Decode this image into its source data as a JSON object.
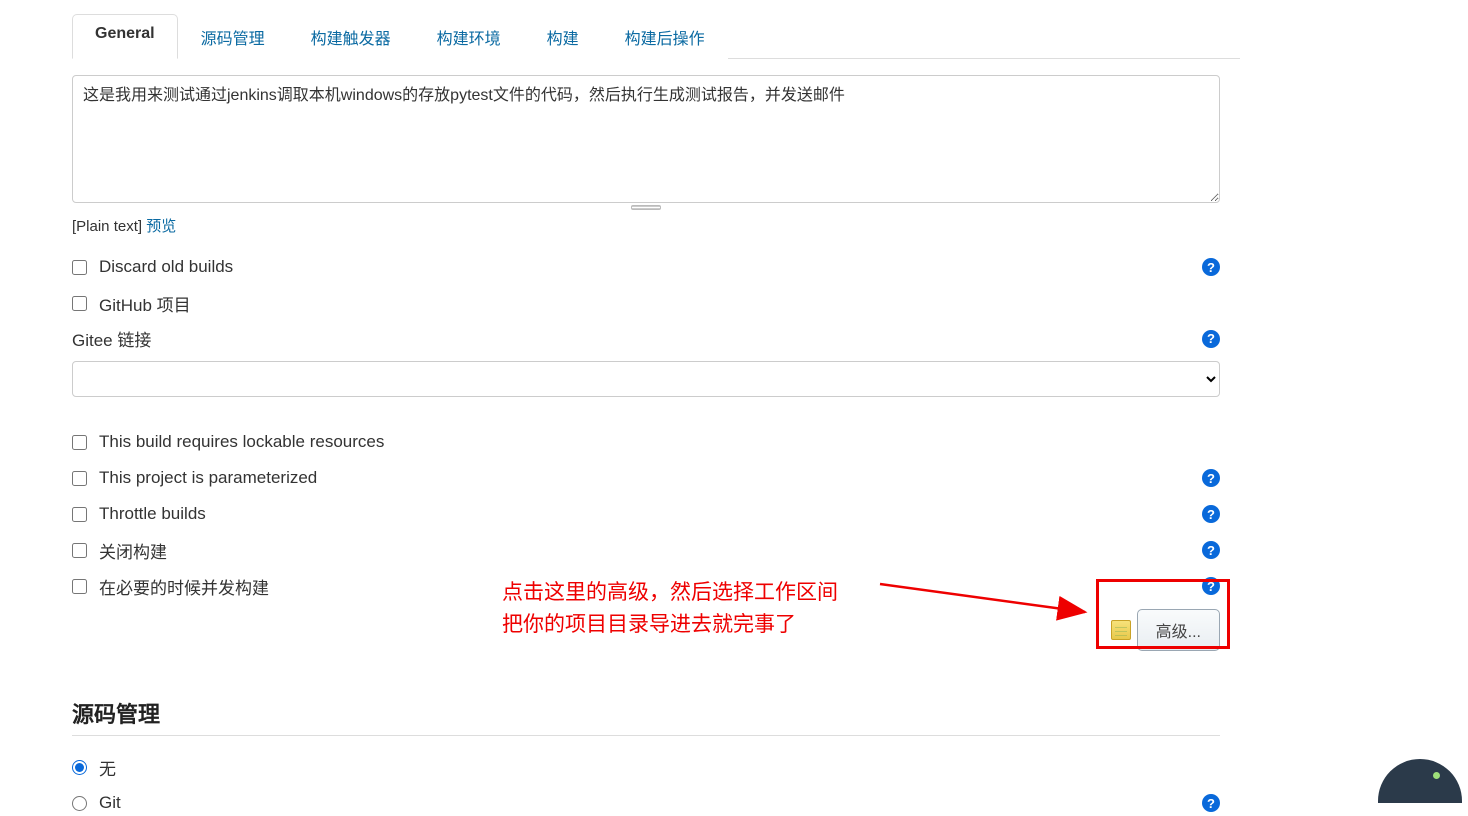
{
  "tabs": {
    "general": "General",
    "scm": "源码管理",
    "triggers": "构建触发器",
    "env": "构建环境",
    "build": "构建",
    "postbuild": "构建后操作"
  },
  "description": "这是我用来测试通过jenkins调取本机windows的存放pytest文件的代码，然后执行生成测试报告，并发送邮件",
  "plain_text_label": "[Plain text] ",
  "preview_link": "预览",
  "options": {
    "discard_old": "Discard old builds",
    "github_project": "GitHub 项目",
    "gitee_label": "Gitee 链接",
    "lockable": "This build requires lockable resources",
    "parameterized": "This project is parameterized",
    "throttle": "Throttle builds",
    "disable": "关闭构建",
    "concurrent": "在必要的时候并发构建"
  },
  "advanced_btn": "高级...",
  "annotation_line1": "点击这里的高级，然后选择工作区间",
  "annotation_line2": "把你的项目目录导进去就完事了",
  "section_scm_heading": "源码管理",
  "scm_options": {
    "none": "无",
    "git": "Git"
  }
}
